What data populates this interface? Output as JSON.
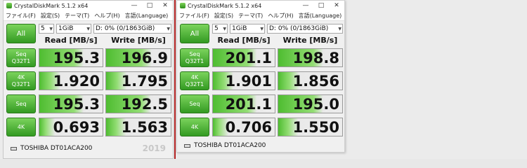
{
  "windows": [
    {
      "title": "CrystalDiskMark 5.1.2 x64",
      "menu": [
        "ファイル(F)",
        "設定(S)",
        "テーマ(T)",
        "ヘルプ(H)",
        "言語(Language)"
      ],
      "all_label": "All",
      "count": "5",
      "size": "1GiB",
      "drive": "D: 0% (0/1863GiB)",
      "read_header": "Read [MB/s]",
      "write_header": "Write [MB/s]",
      "rows": [
        {
          "label1": "Seq",
          "label2": "Q32T1",
          "read": "195.3",
          "write": "196.9",
          "read_fill": 0.55,
          "write_fill": 0.55
        },
        {
          "label1": "4K",
          "label2": "Q32T1",
          "read": "1.920",
          "write": "1.795",
          "read_fill": 0.18,
          "write_fill": 0.17
        },
        {
          "label1": "Seq",
          "label2": "",
          "read": "195.3",
          "write": "192.5",
          "read_fill": 0.55,
          "write_fill": 0.54
        },
        {
          "label1": "4K",
          "label2": "",
          "read": "0.693",
          "write": "1.563",
          "read_fill": 0.1,
          "write_fill": 0.16
        }
      ],
      "drive_name": "TOSHIBA DT01ACA200",
      "year": "2019",
      "win_controls": {
        "minimize": "—",
        "maximize": "□",
        "close": "✕"
      }
    },
    {
      "title": "CrystalDiskMark 5.1.2 x64",
      "menu": [
        "ファイル(F)",
        "設定(S)",
        "テーマ(T)",
        "ヘルプ(H)",
        "言語(Language)"
      ],
      "all_label": "All",
      "count": "5",
      "size": "1GiB",
      "drive": "D: 0% (0/1863GiB)",
      "read_header": "Read [MB/s]",
      "write_header": "Write [MB/s]",
      "rows": [
        {
          "label1": "Seq",
          "label2": "Q32T1",
          "read": "201.1",
          "write": "198.8",
          "read_fill": 0.56,
          "write_fill": 0.55
        },
        {
          "label1": "4K",
          "label2": "Q32T1",
          "read": "1.901",
          "write": "1.856",
          "read_fill": 0.18,
          "write_fill": 0.18
        },
        {
          "label1": "Seq",
          "label2": "",
          "read": "201.1",
          "write": "195.0",
          "read_fill": 0.56,
          "write_fill": 0.55
        },
        {
          "label1": "4K",
          "label2": "",
          "read": "0.706",
          "write": "1.550",
          "read_fill": 0.1,
          "write_fill": 0.16
        }
      ],
      "drive_name": "TOSHIBA DT01ACA200",
      "win_controls": {
        "minimize": "—",
        "maximize": "□",
        "close": "✕"
      }
    }
  ],
  "colors": {
    "accent_green": "#339a22",
    "divider_red": "#b02020"
  }
}
